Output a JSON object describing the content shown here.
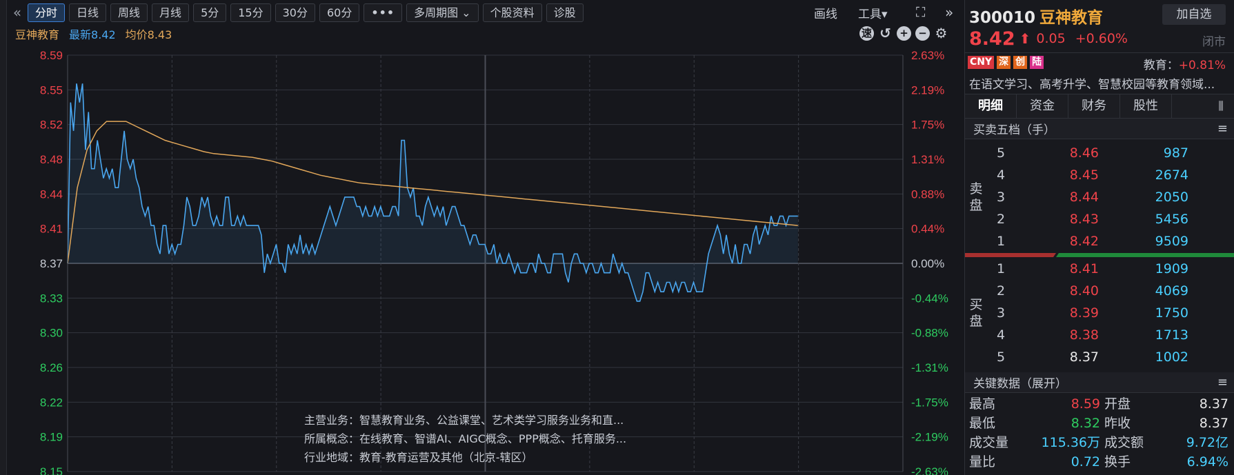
{
  "toolbar": {
    "back_icon": "double-chevron-left-icon",
    "buttons": [
      {
        "label": "分时",
        "active": true
      },
      {
        "label": "日线"
      },
      {
        "label": "周线"
      },
      {
        "label": "月线"
      },
      {
        "label": "5分"
      },
      {
        "label": "15分"
      },
      {
        "label": "30分"
      },
      {
        "label": "60分"
      },
      {
        "label": "•••"
      },
      {
        "label": "多周期图 ⌄"
      },
      {
        "label": "个股资料"
      },
      {
        "label": "诊股"
      }
    ],
    "draw_label": "画线",
    "tools_label": "工具▾",
    "expand_icon": "expand-icon",
    "collapse_icon": "double-chevron-right-icon"
  },
  "chart_header": {
    "name": "豆神教育",
    "latest": "最新8.42",
    "avg": "均价8.43"
  },
  "chart_tools": [
    "speed-icon",
    "undo-icon",
    "zoom-in-icon",
    "zoom-out-icon",
    "settings-icon"
  ],
  "info": {
    "main_business": "主营业务：智慧教育业务、公益课堂、艺术类学习服务业务和直...",
    "concepts": "所属概念：在线教育、智谱AI、AIGC概念、PPP概念、托育服务...",
    "industry_region": "行业地域：教育-教育运营及其他（北京-辖区）"
  },
  "stock": {
    "code": "300010",
    "name": "豆神教育",
    "add_label": "加自选",
    "price": "8.42",
    "change": "0.05",
    "change_pct": "+0.60%",
    "status": "闭市",
    "tags": [
      {
        "text": "CNY",
        "color": "#d9363e"
      },
      {
        "text": "深",
        "color": "#e0641c"
      },
      {
        "text": "创",
        "color": "#e0641c"
      },
      {
        "text": "陆",
        "color": "#d9308a"
      }
    ],
    "industry_label": "教育：",
    "industry_pct": "+0.81%",
    "description": "在语文学习、高考升学、智慧校园等教育领域..."
  },
  "tabs": [
    {
      "label": "明细",
      "active": true
    },
    {
      "label": "资金"
    },
    {
      "label": "财务"
    },
    {
      "label": "股性"
    }
  ],
  "tab_extra_icon": "split-icon",
  "orderbook": {
    "title": "买卖五档（手）",
    "sell_label": "卖\n盘",
    "buy_label": "买\n盘",
    "sell": [
      {
        "level": "5",
        "price": "8.46",
        "vol": "987",
        "color": "red"
      },
      {
        "level": "4",
        "price": "8.45",
        "vol": "2674",
        "color": "red"
      },
      {
        "level": "3",
        "price": "8.44",
        "vol": "2050",
        "color": "red"
      },
      {
        "level": "2",
        "price": "8.43",
        "vol": "5456",
        "color": "red"
      },
      {
        "level": "1",
        "price": "8.42",
        "vol": "9509",
        "color": "red"
      }
    ],
    "buy": [
      {
        "level": "1",
        "price": "8.41",
        "vol": "1909",
        "color": "red"
      },
      {
        "level": "2",
        "price": "8.40",
        "vol": "4069",
        "color": "red"
      },
      {
        "level": "3",
        "price": "8.39",
        "vol": "1750",
        "color": "red"
      },
      {
        "level": "4",
        "price": "8.38",
        "vol": "1713",
        "color": "red"
      },
      {
        "level": "5",
        "price": "8.37",
        "vol": "1002",
        "color": "white"
      }
    ]
  },
  "key_data": {
    "title": "关键数据（展开）",
    "rows": [
      {
        "k1": "最高",
        "v1": "8.59",
        "c1": "red",
        "k2": "开盘",
        "v2": "8.37",
        "c2": "white"
      },
      {
        "k1": "最低",
        "v1": "8.32",
        "c1": "green",
        "k2": "昨收",
        "v2": "8.37",
        "c2": "white"
      },
      {
        "k1": "成交量",
        "v1": "115.36万",
        "c1": "cyan",
        "k2": "成交额",
        "v2": "9.72亿",
        "c2": "cyan"
      },
      {
        "k1": "量比",
        "v1": "0.72",
        "c1": "cyan",
        "k2": "换手",
        "v2": "6.94%",
        "c2": "cyan"
      }
    ]
  },
  "colors": {
    "up": "#f0434a",
    "down": "#2ecc60",
    "price_line": "#4aa7f0",
    "avg_line": "#e3a85a",
    "grid": "#3a3d45"
  },
  "chart_data": {
    "type": "line",
    "prev_close": 8.37,
    "ylim": [
      8.15,
      8.59
    ],
    "y_ticks_left": [
      "8.59",
      "8.55",
      "8.52",
      "8.48",
      "8.44",
      "8.41",
      "8.37",
      "8.33",
      "8.30",
      "8.26",
      "8.22",
      "8.19",
      "8.15"
    ],
    "y_ticks_right": [
      "2.63%",
      "2.19%",
      "1.75%",
      "1.31%",
      "0.88%",
      "0.44%",
      "0.00%",
      "-0.44%",
      "-0.88%",
      "-1.31%",
      "-1.75%",
      "-2.19%",
      "-2.63%"
    ],
    "series": [
      {
        "name": "最新",
        "values": [
          8.37,
          8.54,
          8.51,
          8.56,
          8.54,
          8.56,
          8.49,
          8.53,
          8.47,
          8.47,
          8.5,
          8.48,
          8.46,
          8.47,
          8.46,
          8.47,
          8.45,
          8.45,
          8.48,
          8.51,
          8.48,
          8.47,
          8.48,
          8.46,
          8.45,
          8.43,
          8.42,
          8.43,
          8.41,
          8.41,
          8.39,
          8.38,
          8.41,
          8.41,
          8.38,
          8.39,
          8.38,
          8.39,
          8.39,
          8.41,
          8.44,
          8.43,
          8.41,
          8.41,
          8.42,
          8.44,
          8.43,
          8.44,
          8.42,
          8.41,
          8.42,
          8.41,
          8.41,
          8.44,
          8.44,
          8.41,
          8.41,
          8.42,
          8.41,
          8.42,
          8.41,
          8.41,
          8.41,
          8.41,
          8.41,
          8.4,
          8.36,
          8.38,
          8.37,
          8.38,
          8.39,
          8.37,
          8.37,
          8.36,
          8.39,
          8.38,
          8.39,
          8.38,
          8.4,
          8.38,
          8.39,
          8.38,
          8.39,
          8.38,
          8.39,
          8.4,
          8.41,
          8.42,
          8.43,
          8.42,
          8.41,
          8.42,
          8.43,
          8.44,
          8.44,
          8.44,
          8.44,
          8.43,
          8.43,
          8.42,
          8.43,
          8.42,
          8.42,
          8.43,
          8.42,
          8.43,
          8.42,
          8.42,
          8.42,
          8.43,
          8.43,
          8.42,
          8.5,
          8.5,
          8.45,
          8.44,
          8.45,
          8.42,
          8.42,
          8.41,
          8.43,
          8.44,
          8.43,
          8.42,
          8.43,
          8.42,
          8.43,
          8.41,
          8.42,
          8.43,
          8.43,
          8.42,
          8.41,
          8.41,
          8.4,
          8.39,
          8.4,
          8.4,
          8.39,
          8.39,
          8.39,
          8.38,
          8.38,
          8.39,
          8.37,
          8.38,
          8.37,
          8.37,
          8.38,
          8.37,
          8.36,
          8.37,
          8.36,
          8.36,
          8.36,
          8.37,
          8.37,
          8.36,
          8.38,
          8.37,
          8.37,
          8.36,
          8.36,
          8.38,
          8.38,
          8.38,
          8.38,
          8.36,
          8.35,
          8.37,
          8.38,
          8.38,
          8.37,
          8.37,
          8.36,
          8.37,
          8.37,
          8.36,
          8.36,
          8.37,
          8.36,
          8.36,
          8.36,
          8.38,
          8.37,
          8.36,
          8.37,
          8.36,
          8.36,
          8.35,
          8.34,
          8.33,
          8.33,
          8.34,
          8.36,
          8.36,
          8.35,
          8.34,
          8.35,
          8.34,
          8.34,
          8.35,
          8.35,
          8.34,
          8.35,
          8.34,
          8.35,
          8.35,
          8.34,
          8.34,
          8.35,
          8.34,
          8.34,
          8.34,
          8.36,
          8.38,
          8.39,
          8.4,
          8.41,
          8.4,
          8.38,
          8.4,
          8.38,
          8.37,
          8.39,
          8.37,
          8.37,
          8.39,
          8.39,
          8.38,
          8.4,
          8.41,
          8.39,
          8.4,
          8.41,
          8.4,
          8.42,
          8.41,
          8.41,
          8.42,
          8.42,
          8.41,
          8.42,
          8.42,
          8.42,
          8.42
        ]
      },
      {
        "name": "均价",
        "values": [
          8.37,
          8.45,
          8.49,
          8.51,
          8.52,
          8.52,
          8.52,
          8.515,
          8.51,
          8.505,
          8.5,
          8.497,
          8.494,
          8.491,
          8.488,
          8.486,
          8.485,
          8.484,
          8.483,
          8.482,
          8.48,
          8.478,
          8.475,
          8.472,
          8.469,
          8.466,
          8.463,
          8.461,
          8.459,
          8.457,
          8.455,
          8.454,
          8.453,
          8.452,
          8.451,
          8.45,
          8.449,
          8.448,
          8.447,
          8.446,
          8.445,
          8.444,
          8.443,
          8.442,
          8.441,
          8.44,
          8.439,
          8.438,
          8.437,
          8.436,
          8.435,
          8.434,
          8.433,
          8.432,
          8.431,
          8.43,
          8.429,
          8.428,
          8.427,
          8.426,
          8.425,
          8.424,
          8.423,
          8.422,
          8.421,
          8.42,
          8.419,
          8.418,
          8.417,
          8.416,
          8.415,
          8.414,
          8.413,
          8.412,
          8.411,
          8.41
        ]
      }
    ]
  }
}
